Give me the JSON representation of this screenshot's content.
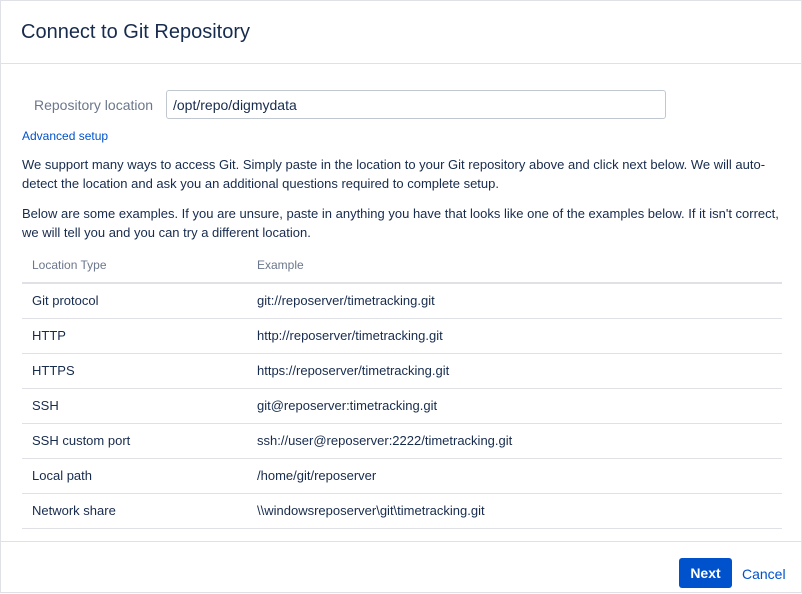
{
  "dialog": {
    "title": "Connect to Git Repository"
  },
  "repo": {
    "label": "Repository location",
    "value": "/opt/repo/digmydata"
  },
  "advanced_setup_label": "Advanced setup",
  "description": {
    "p1": "We support many ways to access Git. Simply paste in the location to your Git repository above and click next below. We will auto-detect the location and ask you an additional questions required to complete setup.",
    "p2": "Below are some examples. If you are unsure, paste in anything you have that looks like one of the examples below. If it isn't correct, we will tell you and you can try a different location."
  },
  "table": {
    "headers": [
      "Location Type",
      "Example"
    ],
    "rows": [
      [
        "Git protocol",
        "git://reposerver/timetracking.git"
      ],
      [
        "HTTP",
        "http://reposerver/timetracking.git"
      ],
      [
        "HTTPS",
        "https://reposerver/timetracking.git"
      ],
      [
        "SSH",
        "git@reposerver:timetracking.git"
      ],
      [
        "SSH custom port",
        "ssh://user@reposerver:2222/timetracking.git"
      ],
      [
        "Local path",
        "/home/git/reposerver"
      ],
      [
        "Network share",
        "\\\\windowsreposerver\\git\\timetracking.git"
      ]
    ]
  },
  "footer": {
    "next_label": "Next",
    "cancel_label": "Cancel"
  },
  "colors": {
    "accent": "#0052cc",
    "text": "#172b4d",
    "muted": "#6b778c",
    "border": "#dfe1e6"
  }
}
